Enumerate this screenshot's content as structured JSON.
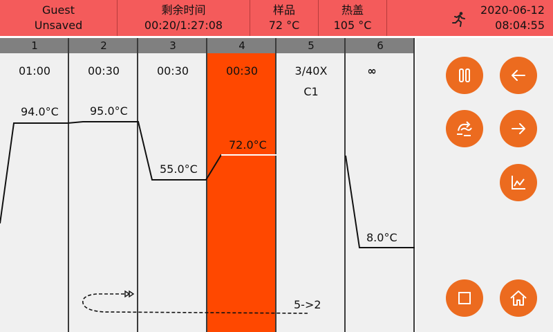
{
  "header": {
    "user": "Guest",
    "save_state": "Unsaved",
    "remaining_label": "剩余时间",
    "remaining_value": "00:20/1:27:08",
    "sample_label": "样品",
    "sample_value": "72 °C",
    "lid_label": "热盖",
    "lid_value": "105 °C",
    "date": "2020-06-12",
    "time": "08:04:55"
  },
  "steps": [
    {
      "num": "1",
      "time": "01:00",
      "sub": "",
      "temp": "94.0°C"
    },
    {
      "num": "2",
      "time": "00:30",
      "sub": "",
      "temp": "95.0°C"
    },
    {
      "num": "3",
      "time": "00:30",
      "sub": "",
      "temp": "55.0°C"
    },
    {
      "num": "4",
      "time": "00:30",
      "sub": "",
      "temp": "72.0°C"
    },
    {
      "num": "5",
      "time": "3/40X",
      "sub": "C1",
      "temp": ""
    },
    {
      "num": "6",
      "time": "∞",
      "sub": "",
      "temp": "8.0°C"
    }
  ],
  "active_step": 4,
  "loop": {
    "label": "5->2"
  },
  "colors": {
    "header_bg": "#f45b5b",
    "active_step": "#ff4800",
    "button": "#ec6b1f",
    "panel_bg": "#f0f0f0",
    "step_header": "#808080"
  },
  "buttons": {
    "pause": "pause-icon",
    "back": "arrow-left-icon",
    "skip": "skip-step-icon",
    "forward": "arrow-right-icon",
    "chart": "line-chart-icon",
    "stop": "stop-square-icon",
    "home": "home-icon"
  }
}
